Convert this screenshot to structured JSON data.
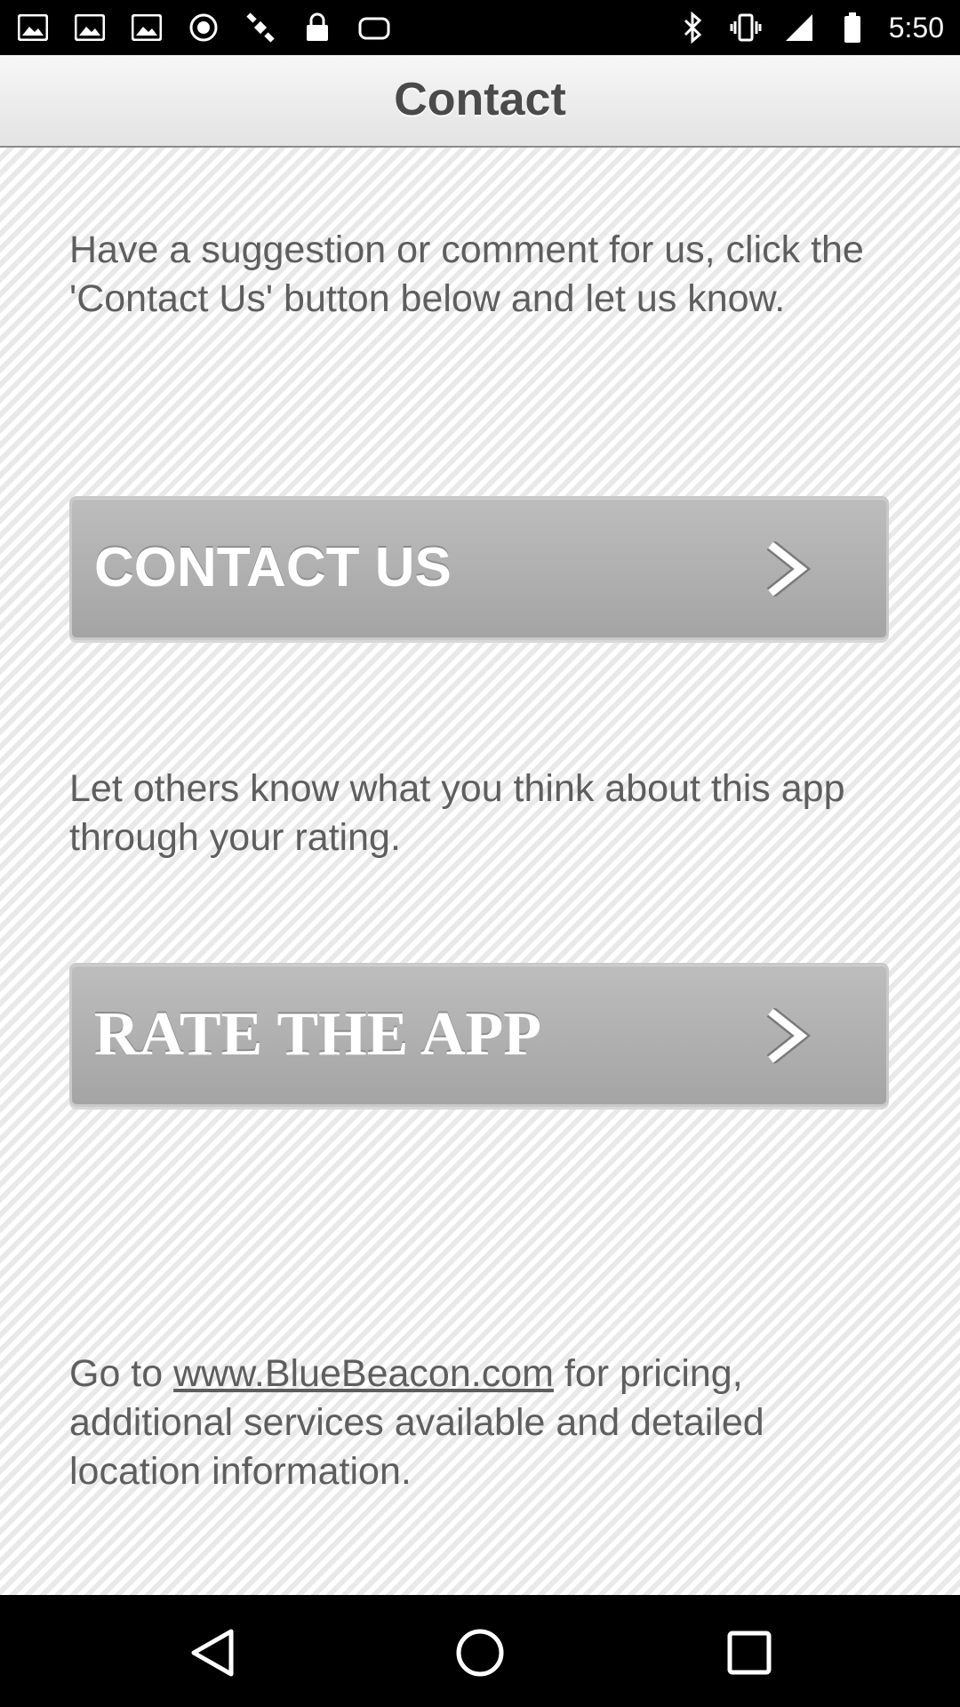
{
  "status_bar": {
    "time": "5:50",
    "left_icons": [
      "image-icon",
      "image-icon",
      "image-icon",
      "block-icon",
      "satellite-icon",
      "lock-icon",
      "cloud-icon"
    ],
    "right_icons": [
      "bluetooth-icon",
      "vibrate-icon",
      "signal-icon",
      "battery-icon"
    ]
  },
  "header": {
    "title": "Contact"
  },
  "main": {
    "intro_text": "Have a suggestion or comment for us, click the 'Contact Us' button below and let us know.",
    "contact_button_label": "CONTACT US",
    "rating_text": "Let others know what you think about this app through your rating.",
    "rate_button_label": "RATE THE APP",
    "footer_prefix": "Go to ",
    "footer_link": "www.BlueBeacon.com",
    "footer_suffix": " for pricing, additional services available and detailed location information."
  },
  "nav_bar": {
    "icons": [
      "back-icon",
      "home-icon",
      "recents-icon"
    ]
  }
}
